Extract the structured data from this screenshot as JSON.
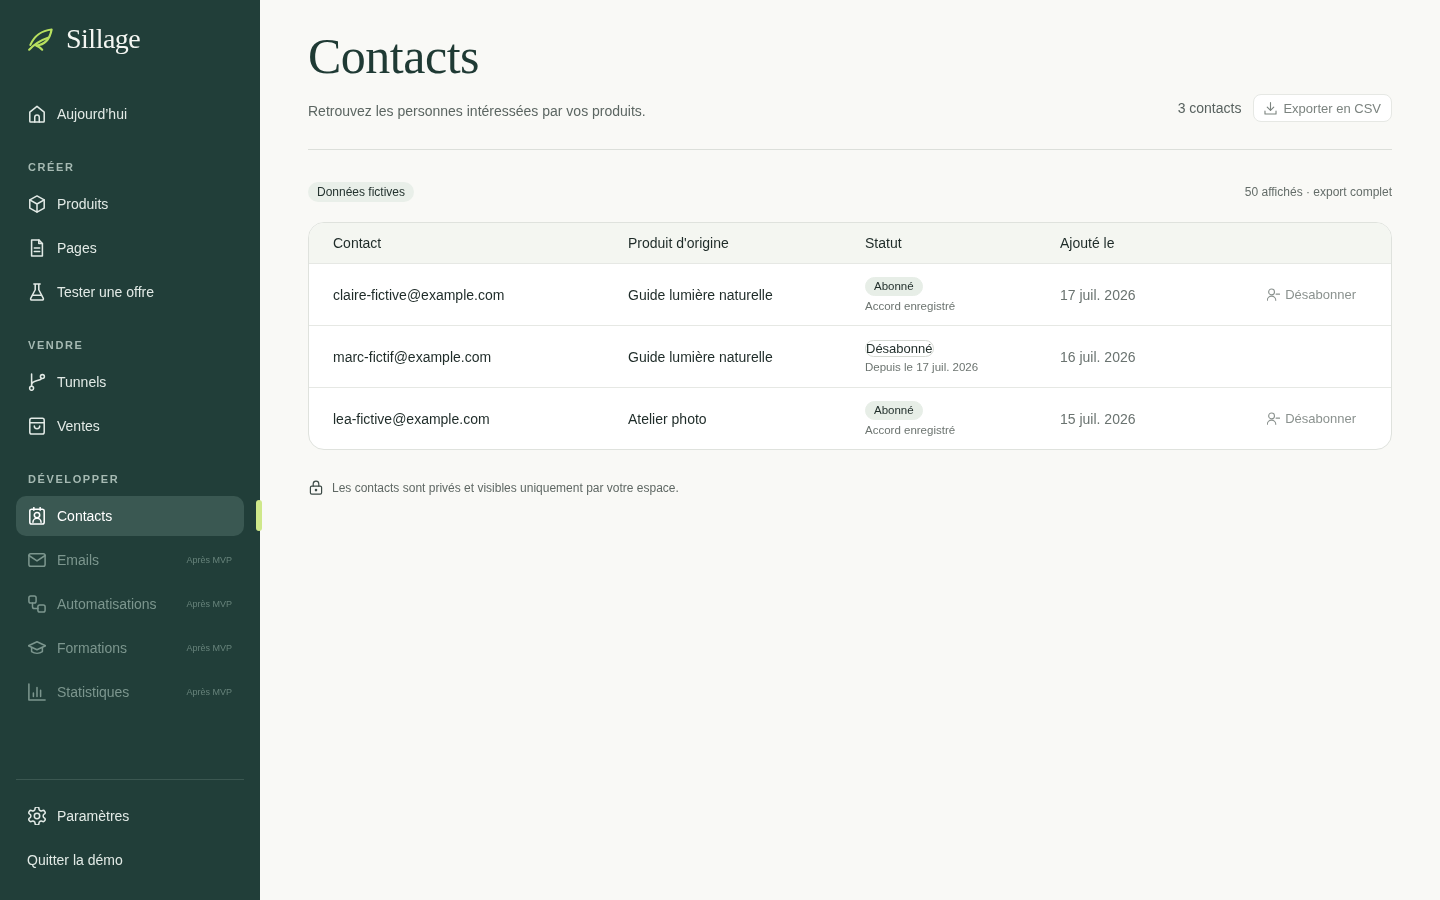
{
  "sidebar": {
    "brand": "Sillage",
    "groups": [
      {
        "items": [
          {
            "label": "Aujourd’hui",
            "selected": false,
            "disabled": false
          }
        ]
      },
      {
        "heading": "CRÉER",
        "items": [
          {
            "label": "Produits",
            "selected": false,
            "disabled": false
          },
          {
            "label": "Pages",
            "selected": false,
            "disabled": false
          },
          {
            "label": "Tester une offre",
            "selected": false,
            "disabled": false
          }
        ]
      },
      {
        "heading": "VENDRE",
        "items": [
          {
            "label": "Tunnels",
            "selected": false,
            "disabled": false
          },
          {
            "label": "Ventes",
            "selected": false,
            "disabled": false
          }
        ]
      },
      {
        "heading": "DÉVELOPPER",
        "items": [
          {
            "label": "Contacts",
            "selected": true,
            "disabled": false
          },
          {
            "label": "Emails",
            "selected": false,
            "disabled": true,
            "badge": "Après MVP"
          },
          {
            "label": "Automatisations",
            "selected": false,
            "disabled": true,
            "badge": "Après MVP"
          },
          {
            "label": "Formations",
            "selected": false,
            "disabled": true,
            "badge": "Après MVP"
          },
          {
            "label": "Statistiques",
            "selected": false,
            "disabled": true,
            "badge": "Après MVP"
          }
        ]
      }
    ],
    "footer": [
      {
        "label": "Paramètres",
        "kind": "icon-link",
        "selected": false
      },
      {
        "label": "Quitter la démo",
        "kind": "text-link",
        "selected": false
      }
    ]
  },
  "header": {
    "title": "Contacts",
    "subtitle": "Retrouvez les personnes intéressées par vos produits.",
    "count": "3 contacts",
    "export_button": "Exporter en CSV"
  },
  "toolbar": {
    "tag": "Données fictives",
    "info": "50 affichés · export complet"
  },
  "table": {
    "columns": [
      "Contact",
      "Produit d'origine",
      "Statut",
      "Ajouté le"
    ],
    "rows": [
      {
        "contact": "claire-fictive@example.com",
        "product": "Guide lumière naturelle",
        "status": {
          "label": "Abonné",
          "kind": "subscribed",
          "note": "Accord enregistré"
        },
        "added": "17 juil. 2026",
        "action": "Désabonner"
      },
      {
        "contact": "marc-fictif@example.com",
        "product": "Guide lumière naturelle",
        "status": {
          "label": "Désabonné",
          "kind": "unsubscribed",
          "note": "Depuis le 17 juil. 2026"
        },
        "added": "16 juil. 2026"
      },
      {
        "contact": "lea-fictive@example.com",
        "product": "Atelier photo",
        "status": {
          "label": "Abonné",
          "kind": "subscribed",
          "note": "Accord enregistré"
        },
        "added": "15 juil. 2026",
        "action": "Désabonner"
      }
    ]
  },
  "privacy_note": "Les contacts sont privés et visibles uniquement par votre espace."
}
